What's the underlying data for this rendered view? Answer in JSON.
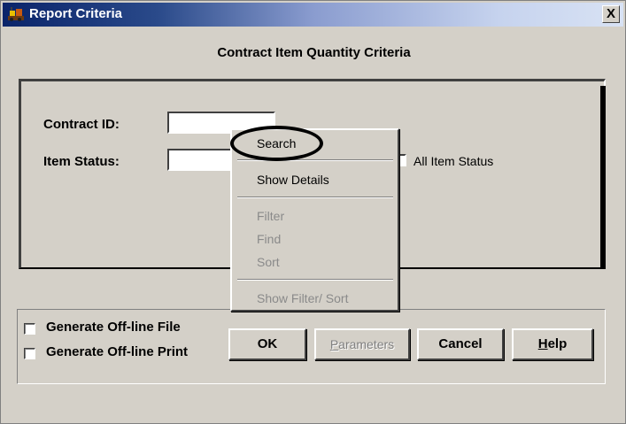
{
  "window": {
    "title": "Report Criteria",
    "close_label": "X",
    "heading": "Contract Item Quantity Criteria"
  },
  "form": {
    "contract_id_label": "Contract ID:",
    "contract_id_value": "",
    "item_status_label": "Item Status:",
    "item_status_value": "",
    "all_item_status_label": "All Item Status",
    "all_item_status_checked": false
  },
  "context_menu": {
    "items": [
      {
        "label": "Search",
        "enabled": true
      },
      {
        "label": "Show Details",
        "enabled": true
      },
      {
        "label": "Filter",
        "enabled": false
      },
      {
        "label": "Find",
        "enabled": false
      },
      {
        "label": "Sort",
        "enabled": false
      },
      {
        "label": "Show Filter/ Sort",
        "enabled": false
      }
    ],
    "highlighted_item": "Search"
  },
  "options": {
    "generate_offline_file_label": "Generate Off-line File",
    "generate_offline_file_checked": false,
    "generate_offline_print_label": "Generate Off-line Print",
    "generate_offline_print_checked": false
  },
  "buttons": {
    "ok": "OK",
    "parameters": "Parameters",
    "cancel": "Cancel",
    "help": "Help"
  },
  "colors": {
    "title_bar_start": "#0a246a",
    "title_bar_end": "#d8e2f4",
    "dialog_face": "#d4d0c8",
    "annotation_circle": "#000000"
  }
}
